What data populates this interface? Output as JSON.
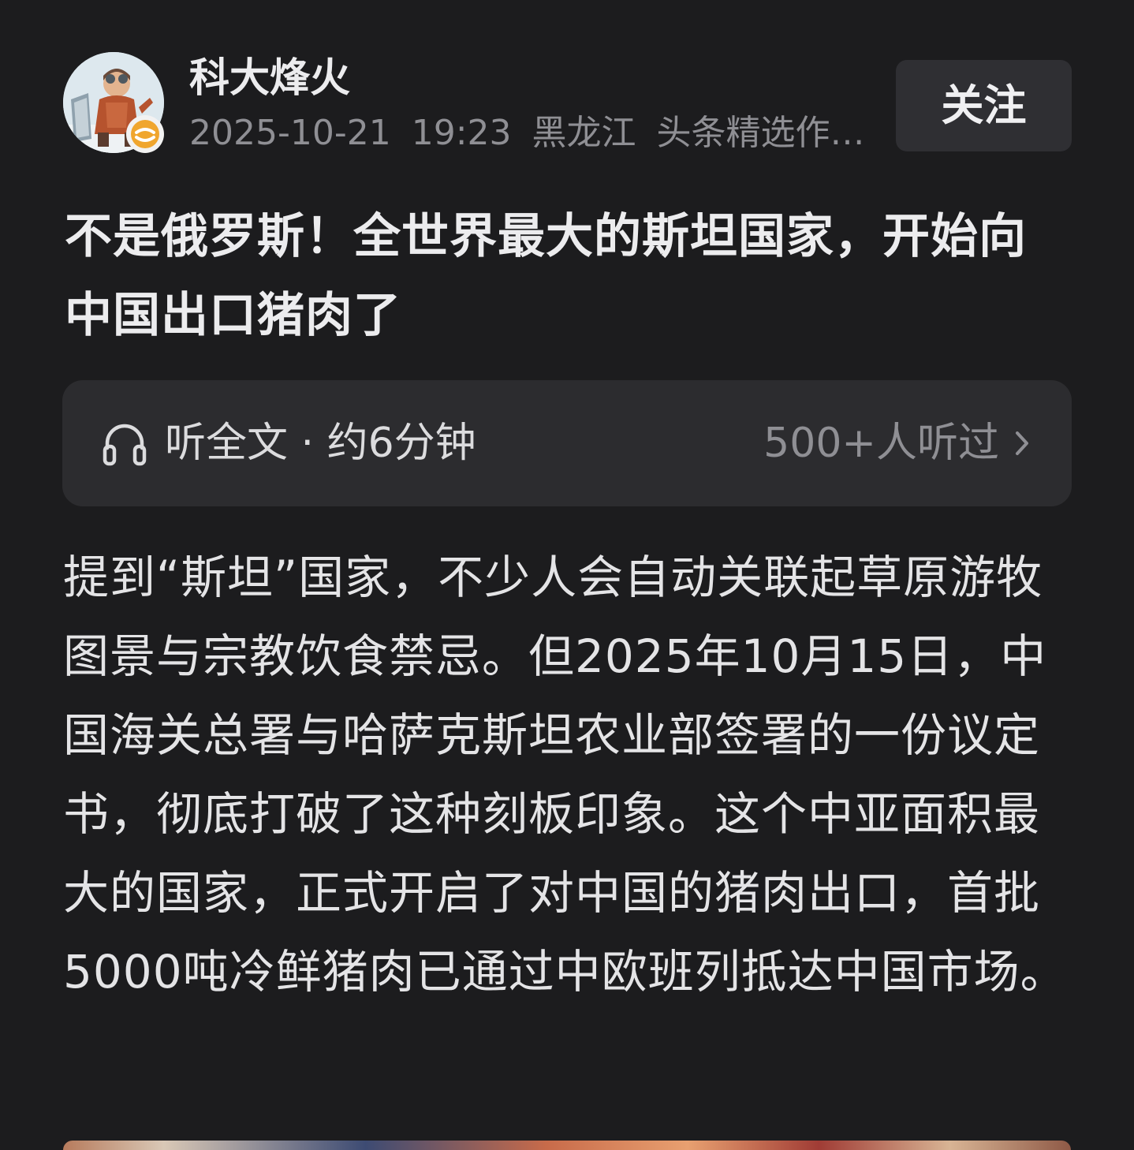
{
  "author": {
    "name": "科大烽火",
    "avatar": "avatar-illustration",
    "badge_icon": "verified-badge-icon"
  },
  "meta": {
    "date": "2025-10-21",
    "time": "19:23",
    "location": "黑龙江",
    "tag": "头条精选作..."
  },
  "follow_label": "关注",
  "title": "不是俄罗斯！全世界最大的斯坦国家，开始向中国出口猪肉了",
  "listen": {
    "icon": "headphone-icon",
    "label": "听全文 · 约6分钟",
    "count": "500+人听过",
    "chevron_icon": "chevron-right-icon"
  },
  "body": "提到“斯坦”国家，不少人会自动关联起草原游牧图景与宗教饮食禁忌。但2025年10月15日，中国海关总署与哈萨克斯坦农业部签署的一份议定书，彻底打破了这种刻板印象。这个中亚面积最大的国家，正式开启了对中国的猪肉出口，首批5000吨冷鲜猪肉已通过中欧班列抵达中国市场。",
  "colors": {
    "background": "#1c1c1e",
    "card": "#2c2c2f",
    "button": "#2f2f33",
    "secondary_text": "#8f8f94",
    "badge": "#f0a62e"
  }
}
